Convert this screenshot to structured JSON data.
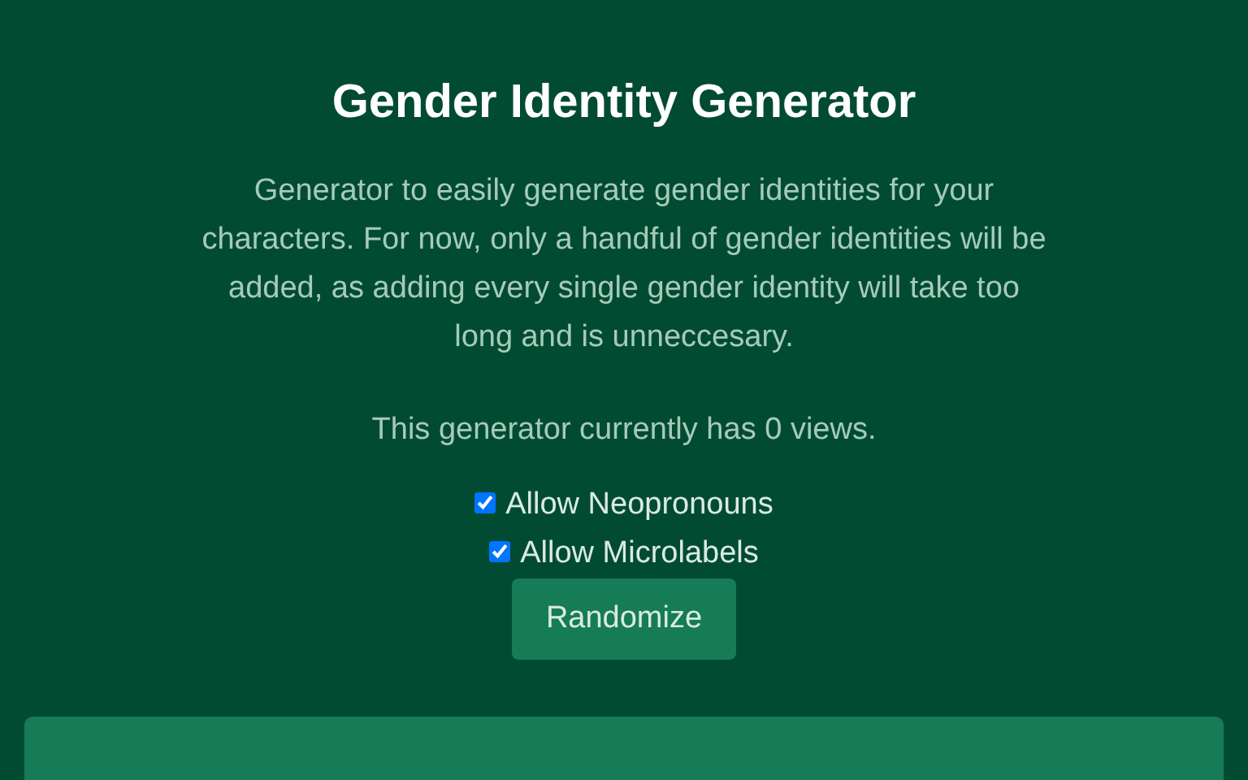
{
  "title": "Gender Identity Generator",
  "description": "Generator to easily generate gender identities for your characters. For now, only a handful of gender identities will be added, as adding every single gender identity will take too long and is unneccesary.",
  "views": "This generator currently has 0 views.",
  "options": [
    {
      "label": "Allow Neopronouns",
      "checked": true
    },
    {
      "label": "Allow Microlabels",
      "checked": true
    }
  ],
  "button": "Randomize"
}
